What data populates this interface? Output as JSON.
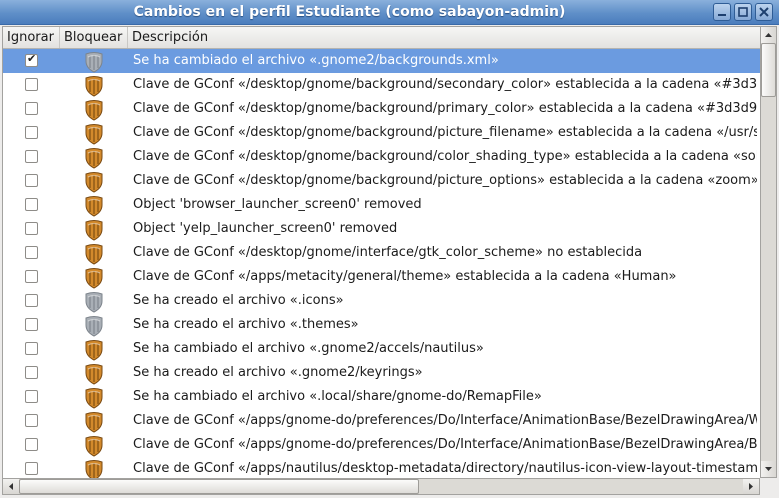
{
  "window": {
    "title": "Cambios en el perfil Estudiante (como sabayon-admin)",
    "buttons": [
      "minimize-icon",
      "maximize-icon",
      "close-icon"
    ]
  },
  "colors": {
    "titlebar": "#5f8fc8",
    "selection": "#6b9be0",
    "lock_shield": "#d38a2c"
  },
  "columns": {
    "ignore": "Ignorar",
    "lock": "Bloquear",
    "description": "Descripción"
  },
  "rows": [
    {
      "ignored": true,
      "locked": false,
      "text": "Se ha cambiado el archivo «.gnome2/backgrounds.xml»"
    },
    {
      "ignored": false,
      "locked": true,
      "text": "Clave de GConf «/desktop/gnome/background/secondary_color» establecida a la cadena «#3d3c"
    },
    {
      "ignored": false,
      "locked": true,
      "text": "Clave de GConf «/desktop/gnome/background/primary_color» establecida a la cadena «#3d3d9a"
    },
    {
      "ignored": false,
      "locked": true,
      "text": "Clave de GConf «/desktop/gnome/background/picture_filename» establecida a la cadena «/usr/s"
    },
    {
      "ignored": false,
      "locked": true,
      "text": "Clave de GConf «/desktop/gnome/background/color_shading_type» establecida a la cadena «sol"
    },
    {
      "ignored": false,
      "locked": true,
      "text": "Clave de GConf «/desktop/gnome/background/picture_options» establecida a la cadena «zoom»"
    },
    {
      "ignored": false,
      "locked": true,
      "text": "Object 'browser_launcher_screen0' removed"
    },
    {
      "ignored": false,
      "locked": true,
      "text": "Object 'yelp_launcher_screen0' removed"
    },
    {
      "ignored": false,
      "locked": true,
      "text": "Clave de GConf «/desktop/gnome/interface/gtk_color_scheme» no establecida"
    },
    {
      "ignored": false,
      "locked": true,
      "text": "Clave de GConf «/apps/metacity/general/theme» establecida a la cadena «Human»"
    },
    {
      "ignored": false,
      "locked": false,
      "text": "Se ha creado el archivo «.icons»"
    },
    {
      "ignored": false,
      "locked": false,
      "text": "Se ha creado el archivo «.themes»"
    },
    {
      "ignored": false,
      "locked": true,
      "text": "Se ha cambiado el archivo «.gnome2/accels/nautilus»"
    },
    {
      "ignored": false,
      "locked": true,
      "text": "Se ha creado el archivo «.gnome2/keyrings»"
    },
    {
      "ignored": false,
      "locked": true,
      "text": "Se ha cambiado el archivo «.local/share/gnome-do/RemapFile»"
    },
    {
      "ignored": false,
      "locked": true,
      "text": "Clave de GConf «/apps/gnome-do/preferences/Do/Interface/AnimationBase/BezelDrawingArea/W"
    },
    {
      "ignored": false,
      "locked": true,
      "text": "Clave de GConf «/apps/gnome-do/preferences/Do/Interface/AnimationBase/BezelDrawingArea/Ba"
    },
    {
      "ignored": false,
      "locked": true,
      "text": "Clave de GConf «/apps/nautilus/desktop-metadata/directory/nautilus-icon-view-layout-timestam"
    }
  ],
  "selected_row": 0
}
